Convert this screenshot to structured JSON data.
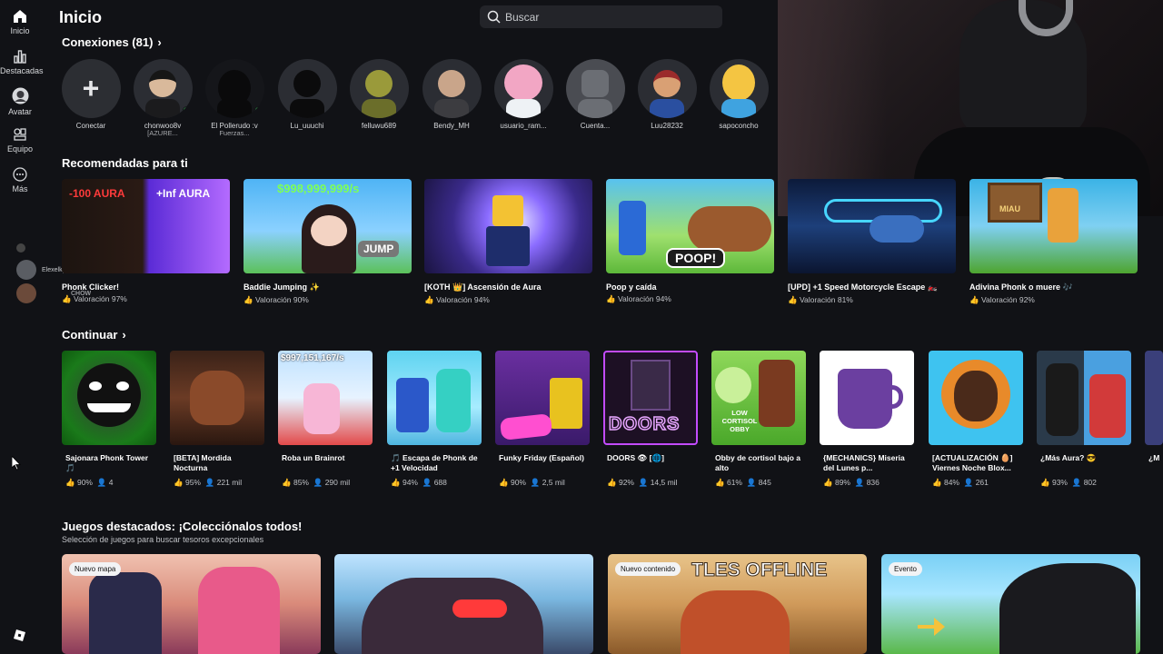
{
  "header": {
    "title": "Inicio",
    "search_placeholder": "Buscar"
  },
  "sidebar": [
    {
      "label": "Inicio",
      "icon": "home-icon"
    },
    {
      "label": "Destacadas",
      "icon": "chart-icon"
    },
    {
      "label": "Avatar",
      "icon": "avatar-icon"
    },
    {
      "label": "Equipo",
      "icon": "inventory-icon"
    },
    {
      "label": "Más",
      "icon": "more-icon"
    }
  ],
  "connections": {
    "title": "Conexiones (81)",
    "add_label": "Conectar",
    "items": [
      {
        "name": "chonwoo8v",
        "sub": "[AZURE...",
        "online": true
      },
      {
        "name": "El Pollerudo :v",
        "sub": "Fuerzas...",
        "online": true
      },
      {
        "name": "Lu_uuuchi",
        "sub": "",
        "online": false
      },
      {
        "name": "felluwu689",
        "sub": "",
        "online": false
      },
      {
        "name": "Bendy_MH",
        "sub": "",
        "online": false
      },
      {
        "name": "usuario_ram...",
        "sub": "",
        "online": false
      },
      {
        "name": "Cuenta...",
        "sub": "",
        "online": false
      },
      {
        "name": "Luu28232",
        "sub": "",
        "online": false
      },
      {
        "name": "sapoconcho",
        "sub": "",
        "online": false
      }
    ]
  },
  "recommended": {
    "title": "Recomendadas para ti",
    "items": [
      {
        "title": "Phonk Clicker!",
        "rating": "Valoración 97%",
        "overlay_a": "-100 AURA",
        "overlay_b": "+Inf AURA"
      },
      {
        "title": "Baddie Jumping ✨",
        "rating": "Valoración 90%",
        "overlay_a": "$998,999,999/s",
        "overlay_b": "JUMP"
      },
      {
        "title": "[KOTH 👑] Ascensión de Aura",
        "rating": "Valoración 94%",
        "overlay_a": "",
        "overlay_b": ""
      },
      {
        "title": "Poop y caída",
        "rating": "Valoración 94%",
        "overlay_a": "POOP!",
        "overlay_b": ""
      },
      {
        "title": "[UPD] +1 Speed Motorcycle Escape 🏍️",
        "rating": "Valoración 81%",
        "overlay_a": "",
        "overlay_b": ""
      },
      {
        "title": "Adivina Phonk o muere 🎶",
        "rating": "Valoración 92%",
        "overlay_a": "MIAU",
        "overlay_b": ""
      }
    ]
  },
  "continue": {
    "title": "Continuar",
    "items": [
      {
        "title": "Sajonara Phonk Tower 🎵",
        "like": "90%",
        "players": "4"
      },
      {
        "title": "[BETA] Mordida Nocturna",
        "like": "95%",
        "players": "221 mil"
      },
      {
        "title": "Roba un Brainrot",
        "like": "85%",
        "players": "290 mil",
        "overlay": "$997,151,167/s"
      },
      {
        "title": "🎵 Escapa de Phonk de +1 Velocidad",
        "like": "94%",
        "players": "688"
      },
      {
        "title": "Funky Friday (Español)",
        "like": "90%",
        "players": "2,5 mil"
      },
      {
        "title": "DOORS 👁 [🌐]",
        "like": "92%",
        "players": "14,5 mil",
        "overlay": "DOORS"
      },
      {
        "title": "Obby de cortisol bajo a alto",
        "like": "61%",
        "players": "845",
        "overlay": "LOW CORTISOL OBBY"
      },
      {
        "title": "{MECHANICS} Miseria del Lunes p...",
        "like": "89%",
        "players": "836"
      },
      {
        "title": "[ACTUALIZACIÓN 🥚] Viernes Noche Blox...",
        "like": "84%",
        "players": "261"
      },
      {
        "title": "¿Más Aura? 😎",
        "like": "93%",
        "players": "802"
      },
      {
        "title": "¿M",
        "like": "",
        "players": ""
      }
    ]
  },
  "featured": {
    "title": "Juegos destacados: ¡Colecciónalos todos!",
    "subtitle": "Selección de juegos para buscar tesoros excepcionales",
    "items": [
      {
        "tag": "Nuevo mapa",
        "overlay": ""
      },
      {
        "tag": "",
        "overlay": ""
      },
      {
        "tag": "Nuevo contenido",
        "overlay": "TLES OFFLINE"
      },
      {
        "tag": "Evento",
        "overlay": ""
      }
    ]
  },
  "side_chat": [
    "Elexelkp67",
    "CHOW"
  ],
  "colors": {
    "background": "#111216",
    "surface": "#232429",
    "online": "#3fbb5a"
  }
}
